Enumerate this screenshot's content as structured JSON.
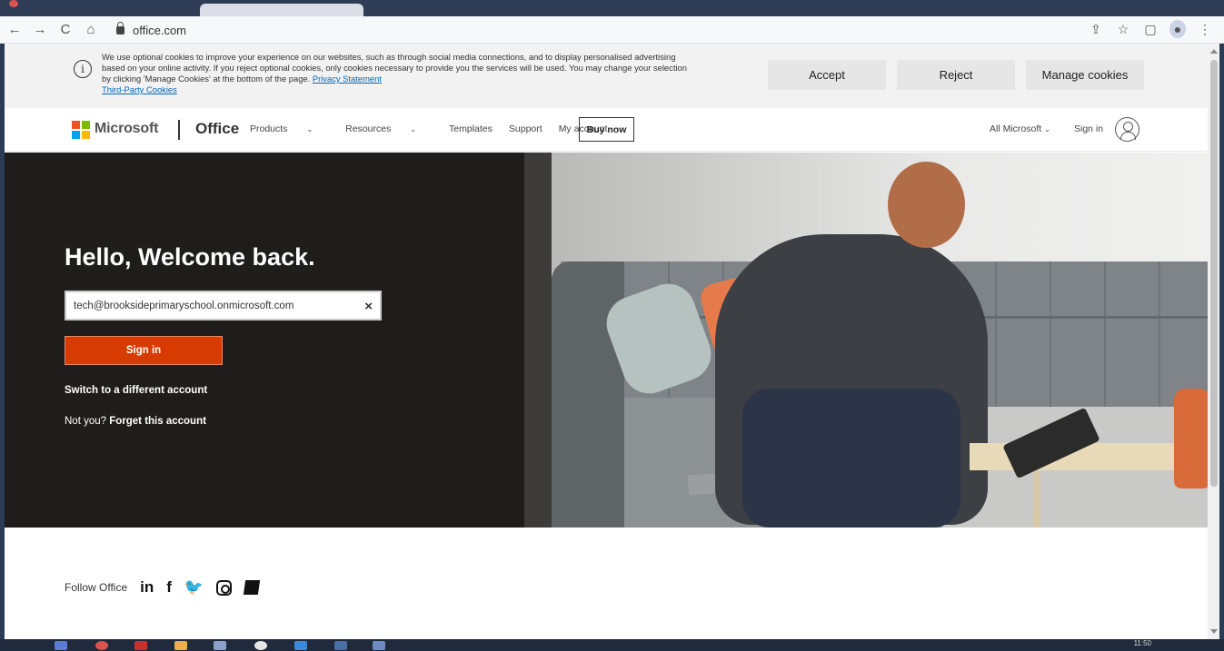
{
  "browser": {
    "url": "office.com",
    "nav": {
      "back": "←",
      "forward": "→",
      "reload": "C",
      "home": "⌂"
    },
    "tools": {
      "share": "⇪",
      "star": "☆",
      "sidepanel": "▢",
      "profile": "●",
      "menu": "⋮"
    }
  },
  "cookie_banner": {
    "info_icon": "i",
    "text": "We use optional cookies to improve your experience on our websites, such as through social media connections, and to display personalised advertising based on your online activity. If you reject optional cookies, only cookies necessary to provide you the services will be used. You may change your selection by clicking 'Manage Cookies' at the bottom of the page.",
    "privacy_link": "Privacy Statement",
    "third_party_link": "Third-Party Cookies",
    "accept": "Accept",
    "reject": "Reject",
    "manage": "Manage cookies"
  },
  "header": {
    "brand": "Microsoft",
    "product": "Office",
    "nav": {
      "products": "Products",
      "resources": "Resources",
      "templates": "Templates",
      "support": "Support",
      "my_account": "My account"
    },
    "chevron": "⌄",
    "buy_now": "Buy now",
    "all_microsoft": "All Microsoft",
    "sign_in": "Sign in"
  },
  "hero": {
    "welcome": "Hello, Welcome back.",
    "email_value": "tech@brooksideprimaryschool.onmicrosoft.com",
    "clear_glyph": "×",
    "sign_in": "Sign in",
    "switch_account": "Switch to a different account",
    "not_you": "Not you?",
    "forget_account": "Forget this account"
  },
  "footer": {
    "follow": "Follow Office",
    "social": {
      "linkedin": "in",
      "facebook": "f",
      "twitter": "🐦"
    }
  },
  "taskbar": {
    "time": "11:50"
  },
  "colors": {
    "accent": "#d83b01",
    "hero_dark": "#1e1d1c",
    "link": "#0067b8"
  }
}
